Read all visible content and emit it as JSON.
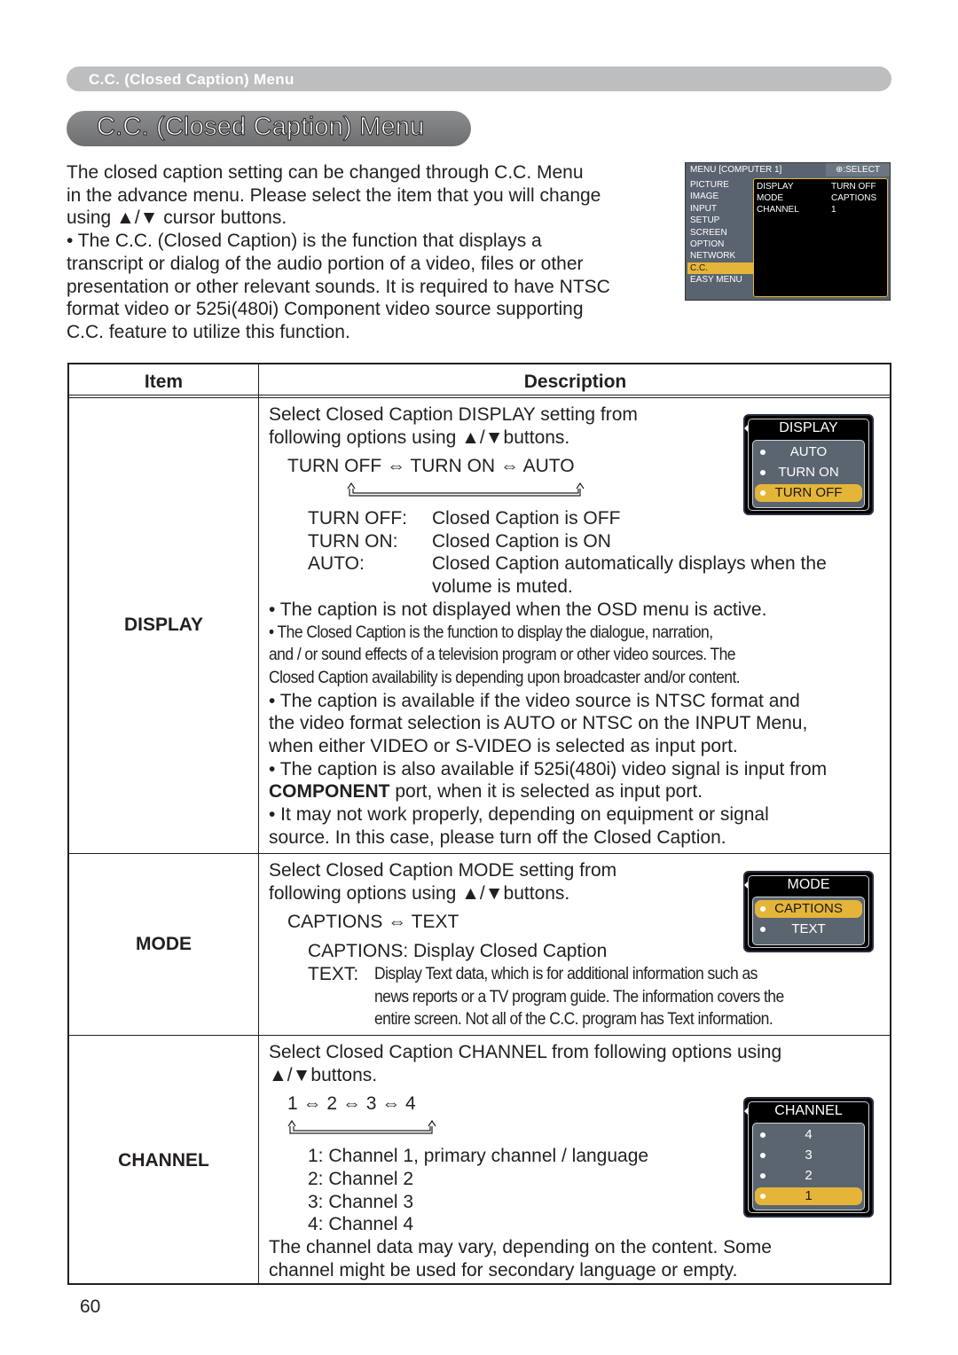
{
  "header_band": "C.C. (Closed Caption) Menu",
  "page_title": "C.C. (Closed Caption) Menu",
  "intro": [
    "The closed caption setting can be changed through C.C. Menu",
    "in the advance menu. Please select the item that you will change",
    "using ▲/▼ cursor buttons.",
    "• The C.C. (Closed Caption) is the function that displays a",
    "transcript or dialog of the audio portion of a video, files or other",
    "presentation or other relevant sounds. It is required to have NTSC",
    "format video or 525i(480i) Component video source supporting",
    "C.C. feature to utilize this function."
  ],
  "osd_menu": {
    "title": "MENU [COMPUTER 1]",
    "select_label": "SELECT",
    "sidebar": [
      "PICTURE",
      "IMAGE",
      "INPUT",
      "SETUP",
      "SCREEN",
      "OPTION",
      "NETWORK",
      "C.C.",
      "EASY MENU"
    ],
    "selected": "C.C.",
    "rows": [
      {
        "item": "DISPLAY",
        "value": "TURN OFF"
      },
      {
        "item": "MODE",
        "value": "CAPTIONS"
      },
      {
        "item": "CHANNEL",
        "value": "1"
      }
    ]
  },
  "table": {
    "headers": {
      "item": "Item",
      "description": "Description"
    },
    "display": {
      "label": "DISPLAY",
      "intro": [
        "Select Closed Caption DISPLAY setting from",
        "following options using ▲/▼buttons."
      ],
      "cycle": "TURN OFF ⇔ TURN ON ⇔ AUTO",
      "defs": [
        {
          "k": "TURN OFF:",
          "v": "Closed Caption is OFF"
        },
        {
          "k": "TURN ON:",
          "v": "Closed Caption is ON"
        },
        {
          "k": "AUTO:",
          "v": "Closed Caption automatically displays when the"
        },
        {
          "k": "",
          "v": "volume is muted."
        }
      ],
      "note1": "• The caption is not displayed when the OSD menu is active.",
      "note2": [
        "• The Closed Caption is the function to display the dialogue, narration,",
        "and / or sound effects of a television program or other video sources. The",
        "Closed Caption availability is depending upon broadcaster and/or content."
      ],
      "note3": [
        "• The caption is available if the video source is NTSC format and",
        "the video format selection is AUTO or NTSC on the INPUT Menu,",
        "when either VIDEO or S-VIDEO is selected as input port.",
        "• The caption is also available if 525i(480i) video signal is input from"
      ],
      "note3_bold": "COMPONENT",
      "note3_rest": " port, when it is selected as input port.",
      "note4": [
        "• It may not work properly, depending on equipment or signal",
        "source. In this case, please turn off the Closed Caption."
      ],
      "osd": {
        "title": "DISPLAY",
        "options": [
          "AUTO",
          "TURN ON",
          "TURN OFF"
        ],
        "selected": "TURN OFF"
      }
    },
    "mode": {
      "label": "MODE",
      "intro": [
        "Select Closed Caption MODE setting from",
        "following options using ▲/▼buttons."
      ],
      "cycle": "CAPTIONS ⇔ TEXT",
      "captions_def": "CAPTIONS:  Display Closed Caption",
      "text_key": "TEXT:",
      "text_def": [
        "Display Text data, which is for additional information such as",
        "news reports or a TV program guide. The information covers the",
        "entire screen. Not all of the C.C. program has Text information."
      ],
      "osd": {
        "title": "MODE",
        "options": [
          "CAPTIONS",
          "TEXT"
        ],
        "selected": "CAPTIONS"
      }
    },
    "channel": {
      "label": "CHANNEL",
      "intro": [
        "Select Closed Caption CHANNEL from following options using",
        "▲/▼buttons."
      ],
      "cycle": "1 ⇔ 2 ⇔ 3 ⇔ 4",
      "defs": [
        "1: Channel 1, primary channel / language",
        "2: Channel 2",
        "3: Channel 3",
        "4: Channel 4"
      ],
      "outro": [
        "The channel data may vary, depending on the content. Some",
        "channel might be used for secondary language or empty."
      ],
      "osd": {
        "title": "CHANNEL",
        "options": [
          "4",
          "3",
          "2",
          "1"
        ],
        "selected": "1"
      }
    }
  },
  "page_number": "60"
}
